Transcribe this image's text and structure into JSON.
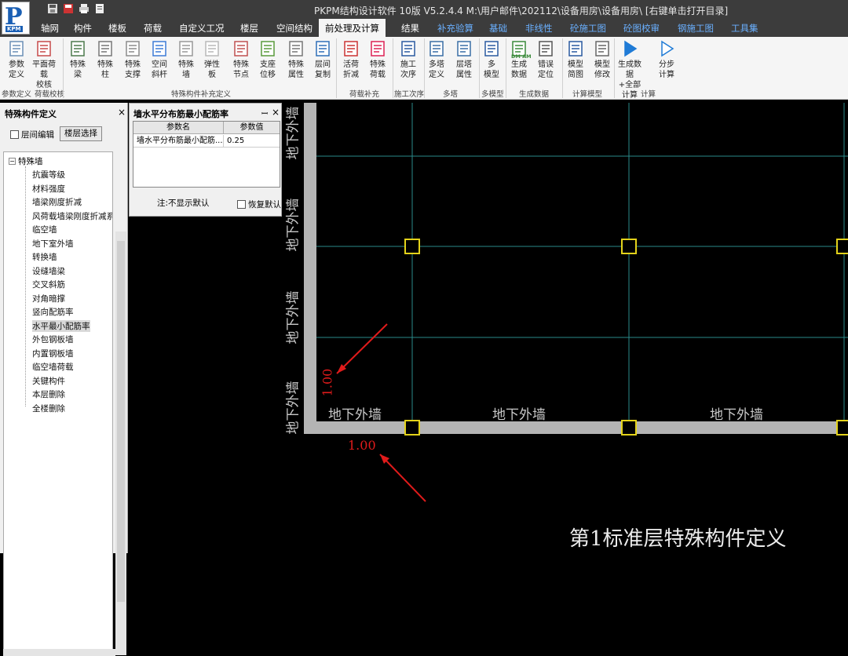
{
  "titlebar": {
    "title": "PKPM结构设计软件 10版 V5.2.4.4 M:\\用户邮件\\202112\\设备用房\\设备用房\\  [右键单击打开目录]"
  },
  "menu": {
    "tabs": [
      {
        "label": "轴网",
        "active": false,
        "blue": false
      },
      {
        "label": "构件",
        "active": false,
        "blue": false
      },
      {
        "label": "楼板",
        "active": false,
        "blue": false
      },
      {
        "label": "荷载",
        "active": false,
        "blue": false
      },
      {
        "label": "自定义工况",
        "active": false,
        "blue": false
      },
      {
        "label": "楼层",
        "active": false,
        "blue": false
      },
      {
        "label": "空间结构",
        "active": false,
        "blue": false
      },
      {
        "label": "前处理及计算",
        "active": true,
        "blue": false
      },
      {
        "label": "结果",
        "active": false,
        "blue": false
      },
      {
        "label": "补充验算",
        "active": false,
        "blue": true
      },
      {
        "label": "基础",
        "active": false,
        "blue": true
      },
      {
        "label": "非线性",
        "active": false,
        "blue": true
      },
      {
        "label": "砼施工图",
        "active": false,
        "blue": true
      },
      {
        "label": "砼图校审",
        "active": false,
        "blue": true
      },
      {
        "label": "钢施工图",
        "active": false,
        "blue": true
      },
      {
        "label": "工具集",
        "active": false,
        "blue": true
      }
    ]
  },
  "ribbon": {
    "buttons": [
      {
        "l1": "参数",
        "l2": "定义",
        "icon": "gear-params-icon"
      },
      {
        "l1": "平面荷载",
        "l2": "校核",
        "icon": "load-check-icon"
      },
      {
        "l1": "特殊",
        "l2": "梁",
        "icon": "special-beam-icon"
      },
      {
        "l1": "特殊",
        "l2": "柱",
        "icon": "special-column-icon"
      },
      {
        "l1": "特殊",
        "l2": "支撑",
        "icon": "special-brace-icon"
      },
      {
        "l1": "空间",
        "l2": "斜杆",
        "icon": "space-rod-icon"
      },
      {
        "l1": "特殊",
        "l2": "墙",
        "icon": "special-wall-icon"
      },
      {
        "l1": "弹性",
        "l2": "板",
        "icon": "elastic-slab-icon"
      },
      {
        "l1": "特殊",
        "l2": "节点",
        "icon": "special-node-icon"
      },
      {
        "l1": "支座",
        "l2": "位移",
        "icon": "support-disp-icon"
      },
      {
        "l1": "特殊",
        "l2": "属性",
        "icon": "special-attr-icon"
      },
      {
        "l1": "层间",
        "l2": "复制",
        "icon": "floor-copy-icon"
      },
      {
        "l1": "活荷",
        "l2": "折减",
        "icon": "live-load-icon"
      },
      {
        "l1": "特殊",
        "l2": "荷载",
        "icon": "special-load-icon"
      },
      {
        "l1": "施工",
        "l2": "次序",
        "icon": "construct-order-icon"
      },
      {
        "l1": "多塔",
        "l2": "定义",
        "icon": "multi-tower-icon"
      },
      {
        "l1": "层塔",
        "l2": "属性",
        "icon": "tower-attr-icon"
      },
      {
        "l1": "多",
        "l2": "模型",
        "icon": "multi-model-icon"
      },
      {
        "l1": "生成",
        "l2": "数据",
        "icon": "gen-data-icon"
      },
      {
        "l1": "错误",
        "l2": "定位",
        "icon": "error-locate-icon"
      },
      {
        "l1": "模型",
        "l2": "简图",
        "icon": "model-diagram-icon"
      },
      {
        "l1": "模型",
        "l2": "修改",
        "icon": "model-edit-icon"
      },
      {
        "l1": "生成数据",
        "l2": "+全部计算",
        "icon": "run-all-icon"
      },
      {
        "l1": "分步",
        "l2": "计算",
        "icon": "step-calc-icon"
      }
    ],
    "groups": [
      "参数定义",
      "荷载校核",
      "特殊构件补充定义",
      "荷载补充",
      "施工次序",
      "多塔",
      "多模型",
      "生成数据",
      "计算模型",
      "计算"
    ],
    "dm_am": "DM AM"
  },
  "leftpanel": {
    "title": "特殊构件定义",
    "close": "×",
    "floor_edit": "层间编辑",
    "floor_select": "楼层选择",
    "root": "特殊墙",
    "items": [
      "抗震等级",
      "材料强度",
      "墙梁刚度折减",
      "风荷载墙梁刚度折减系",
      "临空墙",
      "地下室外墙",
      "转换墙",
      "设缝墙梁",
      "交叉斜筋",
      "对角暗撑",
      "竖向配筋率",
      "水平最小配筋率",
      "外包钢板墙",
      "内置钢板墙",
      "临空墙荷载",
      "关键构件",
      "本层删除",
      "全楼删除"
    ],
    "selected_index": 11
  },
  "parampanel": {
    "title": "墙水平分布筋最小配筋率",
    "pin": "ꟷ",
    "close": "×",
    "col_name": "参数名",
    "col_value": "参数值",
    "row_name": "墙水平分布筋最小配筋...",
    "row_value": "0.25",
    "note": "注:不显示默认",
    "restore": "恢复默认"
  },
  "canvas": {
    "wall_label": "地下外墙",
    "dim_value": "1.00",
    "caption": "第1标准层特殊构件定义",
    "colors": {
      "grid": "#2a8a8a",
      "wall": "#b4b4b4",
      "node": "#e3d21a",
      "dim": "#e01b1b"
    }
  }
}
